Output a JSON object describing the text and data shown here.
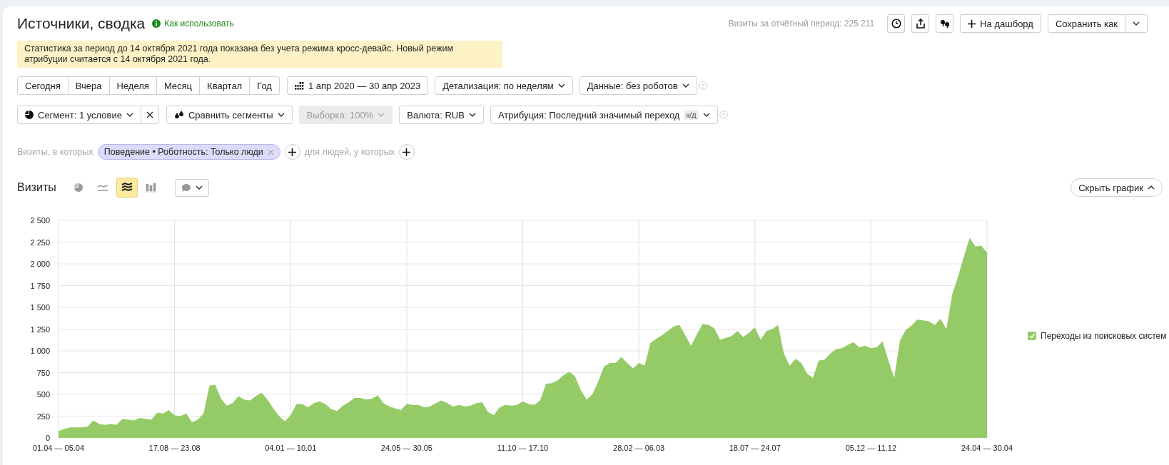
{
  "header": {
    "title": "Источники, сводка",
    "help_link": "Как использовать",
    "visits_total": "Визиты за отчётный период: 225 211",
    "add_to_dashboard": "На дашборд",
    "save_as": "Сохранить как"
  },
  "notice": "Статистика за период до 14 октября 2021 года показана без учета режима кросс-девайс. Новый режим атрибуции считается с 14 октября 2021 года.",
  "periods": [
    {
      "label": "Сегодня",
      "selected": false
    },
    {
      "label": "Вчера",
      "selected": false
    },
    {
      "label": "Неделя",
      "selected": false
    },
    {
      "label": "Месяц",
      "selected": false
    },
    {
      "label": "Квартал",
      "selected": false
    },
    {
      "label": "Год",
      "selected": false
    }
  ],
  "date_range": "1 апр 2020 — 30 апр 2023",
  "detail": "Детализация: по неделям",
  "data_filter": {
    "label": "Данные: без роботов",
    "help": "?"
  },
  "segment": "Сегмент: 1 условие",
  "compare": "Сравнить сегменты",
  "sample": {
    "label": "Выборка: 100%",
    "disabled": true
  },
  "currency": "Валюта: RUB",
  "attribution": {
    "label": "Атрибуция: Последний значимый переход",
    "badge": "к/д",
    "help": "?"
  },
  "filter": {
    "prefix": "Визиты, в которых",
    "chip": "Поведение • Роботность: Только люди",
    "suffix": "для людей, у которых"
  },
  "chart_panel": {
    "title": "Визиты",
    "chart_types": [
      {
        "kind": "pie",
        "selected": false
      },
      {
        "kind": "line",
        "selected": false
      },
      {
        "kind": "area",
        "selected": true
      },
      {
        "kind": "bar",
        "selected": false
      }
    ],
    "hide_button": "Скрыть график",
    "legend": [
      {
        "checked": true
      }
    ],
    "chart_data": {
      "type": "area",
      "grid": true,
      "ylim": [
        0,
        2500
      ],
      "categories": [
        "01.04 — 05.04",
        null,
        null,
        null,
        null,
        null,
        null,
        null,
        null,
        null,
        null,
        null,
        null,
        null,
        null,
        null,
        null,
        null,
        null,
        null,
        "17.08 — 23.08",
        null,
        null,
        null,
        null,
        null,
        null,
        null,
        null,
        null,
        null,
        null,
        null,
        null,
        null,
        null,
        null,
        null,
        null,
        null,
        "04.01 — 10.01",
        null,
        null,
        null,
        null,
        null,
        null,
        null,
        null,
        null,
        null,
        null,
        null,
        null,
        null,
        null,
        null,
        null,
        null,
        null,
        "24.05 — 30.05",
        null,
        null,
        null,
        null,
        null,
        null,
        null,
        null,
        null,
        null,
        null,
        null,
        null,
        null,
        null,
        null,
        null,
        null,
        null,
        "11.10 — 17.10",
        null,
        null,
        null,
        null,
        null,
        null,
        null,
        null,
        null,
        null,
        null,
        null,
        null,
        null,
        null,
        null,
        null,
        null,
        null,
        "28.02 — 06.03",
        null,
        null,
        null,
        null,
        null,
        null,
        null,
        null,
        null,
        null,
        null,
        null,
        null,
        null,
        null,
        null,
        null,
        null,
        null,
        "18.07 — 24.07",
        null,
        null,
        null,
        null,
        null,
        null,
        null,
        null,
        null,
        null,
        null,
        null,
        null,
        null,
        null,
        null,
        null,
        null,
        null,
        "05.12 — 11.12",
        null,
        null,
        null,
        null,
        null,
        null,
        null,
        null,
        null,
        null,
        null,
        null,
        null,
        null,
        null,
        null,
        null,
        null,
        null,
        "24.04 — 30.04"
      ],
      "yticks": [
        {
          "value": 0,
          "label": "0"
        },
        {
          "value": 250,
          "label": "250"
        },
        {
          "value": 500,
          "label": "500"
        },
        {
          "value": 750,
          "label": "750"
        },
        {
          "value": 1000,
          "label": "1 000"
        },
        {
          "value": 1250,
          "label": "1 250"
        },
        {
          "value": 1500,
          "label": "1 500"
        },
        {
          "value": 1750,
          "label": "1 750"
        },
        {
          "value": 2000,
          "label": "2 000"
        },
        {
          "value": 2250,
          "label": "2 250"
        },
        {
          "value": 2500,
          "label": "2 500"
        }
      ],
      "series": [
        {
          "name": "Переходы из поисковых систем",
          "color": "#95cb67",
          "values": [
            80,
            100,
            120,
            120,
            120,
            130,
            200,
            160,
            150,
            160,
            150,
            220,
            210,
            200,
            230,
            220,
            210,
            290,
            280,
            320,
            260,
            250,
            280,
            180,
            210,
            280,
            600,
            610,
            450,
            370,
            400,
            480,
            440,
            430,
            480,
            520,
            440,
            340,
            250,
            190,
            260,
            390,
            390,
            350,
            400,
            420,
            390,
            330,
            310,
            370,
            410,
            460,
            460,
            440,
            450,
            490,
            400,
            360,
            340,
            320,
            390,
            380,
            380,
            350,
            360,
            400,
            430,
            400,
            360,
            380,
            360,
            370,
            400,
            410,
            300,
            260,
            350,
            380,
            370,
            380,
            420,
            390,
            380,
            430,
            620,
            630,
            660,
            720,
            760,
            710,
            550,
            440,
            500,
            650,
            820,
            860,
            860,
            930,
            860,
            800,
            860,
            830,
            1090,
            1140,
            1180,
            1230,
            1280,
            1300,
            1180,
            1060,
            1190,
            1310,
            1300,
            1260,
            1130,
            1150,
            1170,
            1230,
            1160,
            1210,
            1270,
            1130,
            1230,
            1250,
            1300,
            970,
            830,
            910,
            860,
            740,
            690,
            890,
            900,
            970,
            1020,
            1030,
            1070,
            1100,
            1040,
            1060,
            1030,
            1040,
            1110,
            890,
            690,
            1120,
            1240,
            1290,
            1360,
            1350,
            1340,
            1300,
            1370,
            1250,
            1650,
            1850,
            2080,
            2300,
            2200,
            2210,
            2130
          ]
        }
      ]
    }
  }
}
